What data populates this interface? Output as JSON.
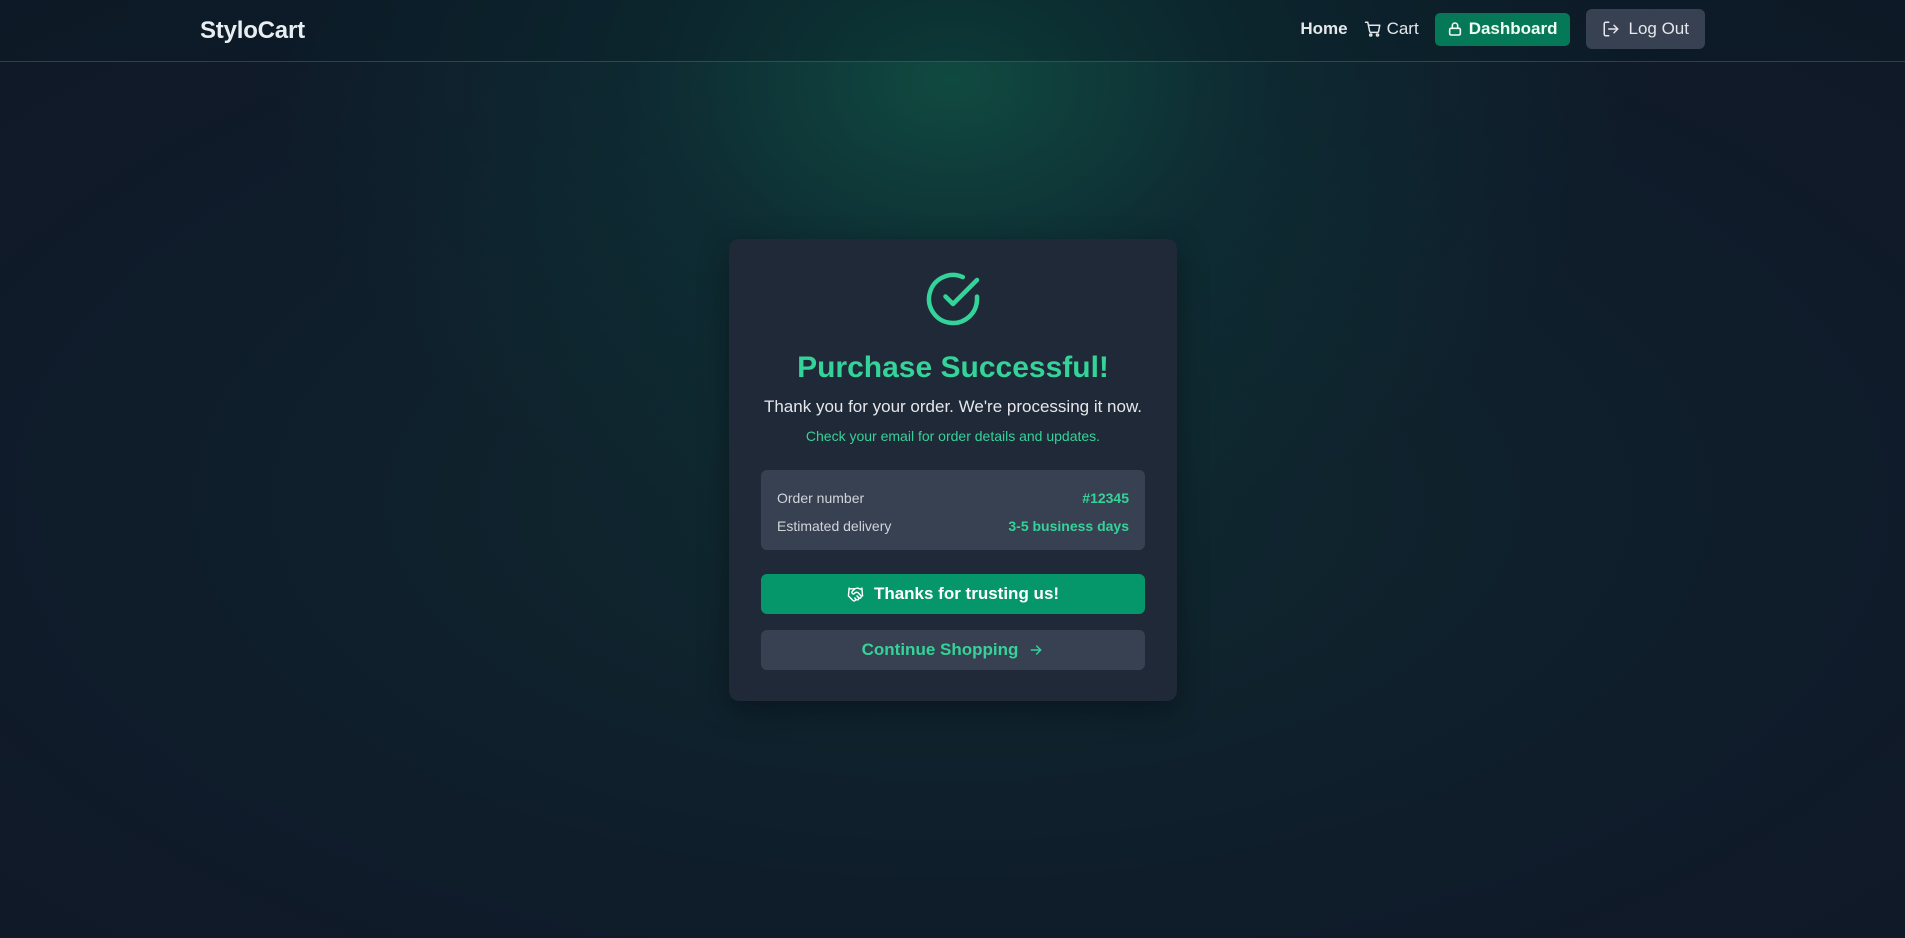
{
  "app": {
    "brand": "StyloCart"
  },
  "nav": {
    "home_label": "Home",
    "cart_label": "Cart",
    "dashboard_label": "Dashboard",
    "logout_label": "Log Out",
    "cart_icon": "cart-icon",
    "dashboard_icon": "lock-icon",
    "logout_icon": "logout-icon"
  },
  "success": {
    "icon": "check-circle-icon",
    "title": "Purchase Successful!",
    "subtitle": "Thank you for your order. We're processing it now.",
    "note": "Check your email for order details and updates.",
    "details": [
      {
        "label": "Order number",
        "value": "#12345"
      },
      {
        "label": "Estimated delivery",
        "value": "3-5 business days"
      }
    ],
    "thanks_button": {
      "label": "Thanks for trusting us!",
      "icon": "handshake-icon"
    },
    "continue_button": {
      "label": "Continue Shopping",
      "icon": "arrow-right-icon"
    }
  },
  "colors": {
    "accent": "#34d399",
    "primary_button": "#059669",
    "dashboard_button": "#047857",
    "card_bg": "#1f2937",
    "panel_bg": "#374151"
  }
}
